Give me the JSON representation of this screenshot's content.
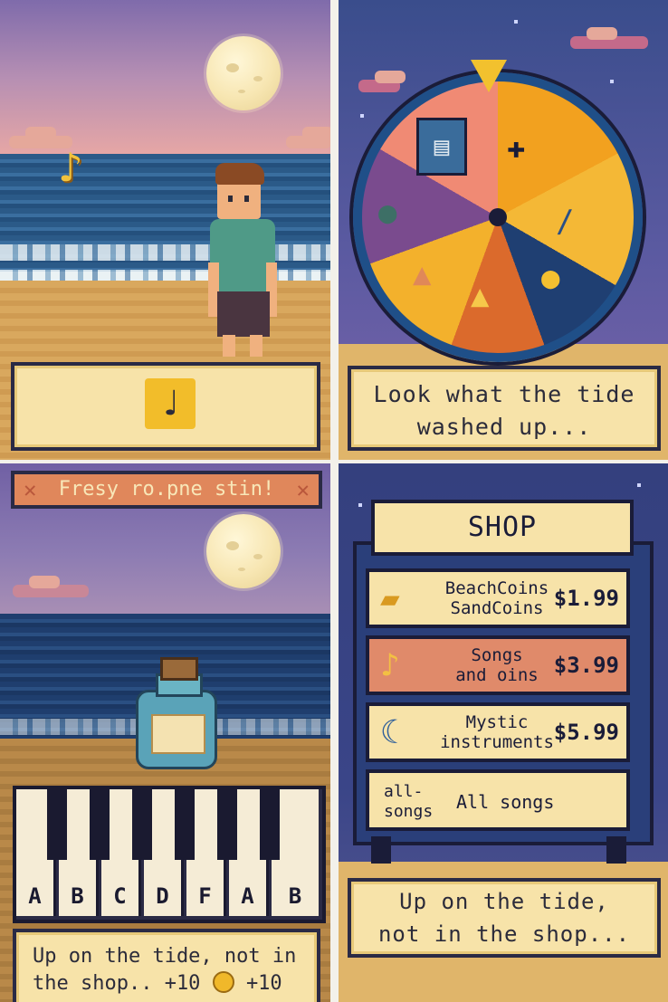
{
  "panel1": {
    "dialog_icon": "music-note-icon",
    "dialog_glyph": "♩",
    "floating_note_glyph": "♪"
  },
  "panel2": {
    "message": "Look what the tide washed up...",
    "wheel_icons": [
      "book-icon",
      "puzzle-piece-icon",
      "feather-icon",
      "coin-icon",
      "flame-icon",
      "sand-pile-icon",
      "globe-icon"
    ]
  },
  "panel3": {
    "banner": "Fresy ro.pne stin!",
    "keys": [
      "A",
      "B",
      "C",
      "D",
      "F",
      "A",
      "B"
    ],
    "message_line1": "Up on the tide, not in",
    "message_line2_prefix": "the shop.. +10",
    "message_line2_suffix": "+10",
    "coin_icon": "coin-icon"
  },
  "panel4": {
    "title": "SHOP",
    "items": [
      {
        "icon": "coin-stack-icon",
        "glyph": "🪙",
        "name_line1": "BeachCoins",
        "name_line2": "SandCoins",
        "price": "$1.99",
        "color": "#f7e3a9"
      },
      {
        "icon": "music-note-icon",
        "glyph": "♪",
        "name_line1": "Songs",
        "name_line2": "and oins",
        "price": "$3.99",
        "color": "#e08a6a"
      },
      {
        "icon": "crescent-moon-icon",
        "glyph": "☾",
        "name_line1": "Mystic",
        "name_line2": "instruments",
        "price": "$5.99",
        "color": "#f7e3a9"
      },
      {
        "icon": "none",
        "glyph": "",
        "name_line1": "all-",
        "name_line2": "songs",
        "desc": "All songs",
        "price": "",
        "color": "#f7e3a9"
      }
    ],
    "message_line1": "Up on the tide,",
    "message_line2": "not in the shop..."
  }
}
